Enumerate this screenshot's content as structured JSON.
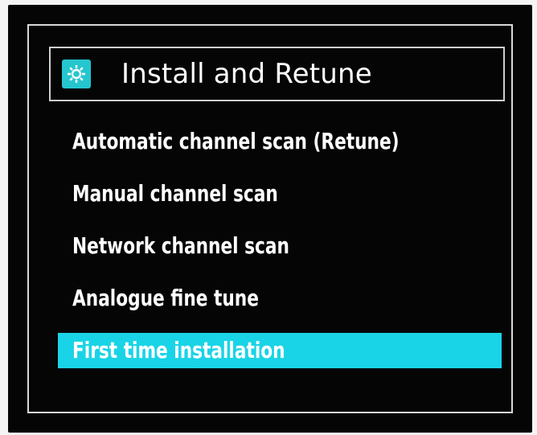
{
  "menu": {
    "title": "Install and Retune",
    "title_icon": "settings-gear-icon",
    "accent_color": "#19d4e6",
    "items": [
      {
        "label": "Automatic channel scan (Retune)",
        "selected": false
      },
      {
        "label": "Manual channel scan",
        "selected": false
      },
      {
        "label": "Network channel scan",
        "selected": false
      },
      {
        "label": "Analogue fine tune",
        "selected": false
      },
      {
        "label": "First time installation",
        "selected": true
      }
    ]
  }
}
